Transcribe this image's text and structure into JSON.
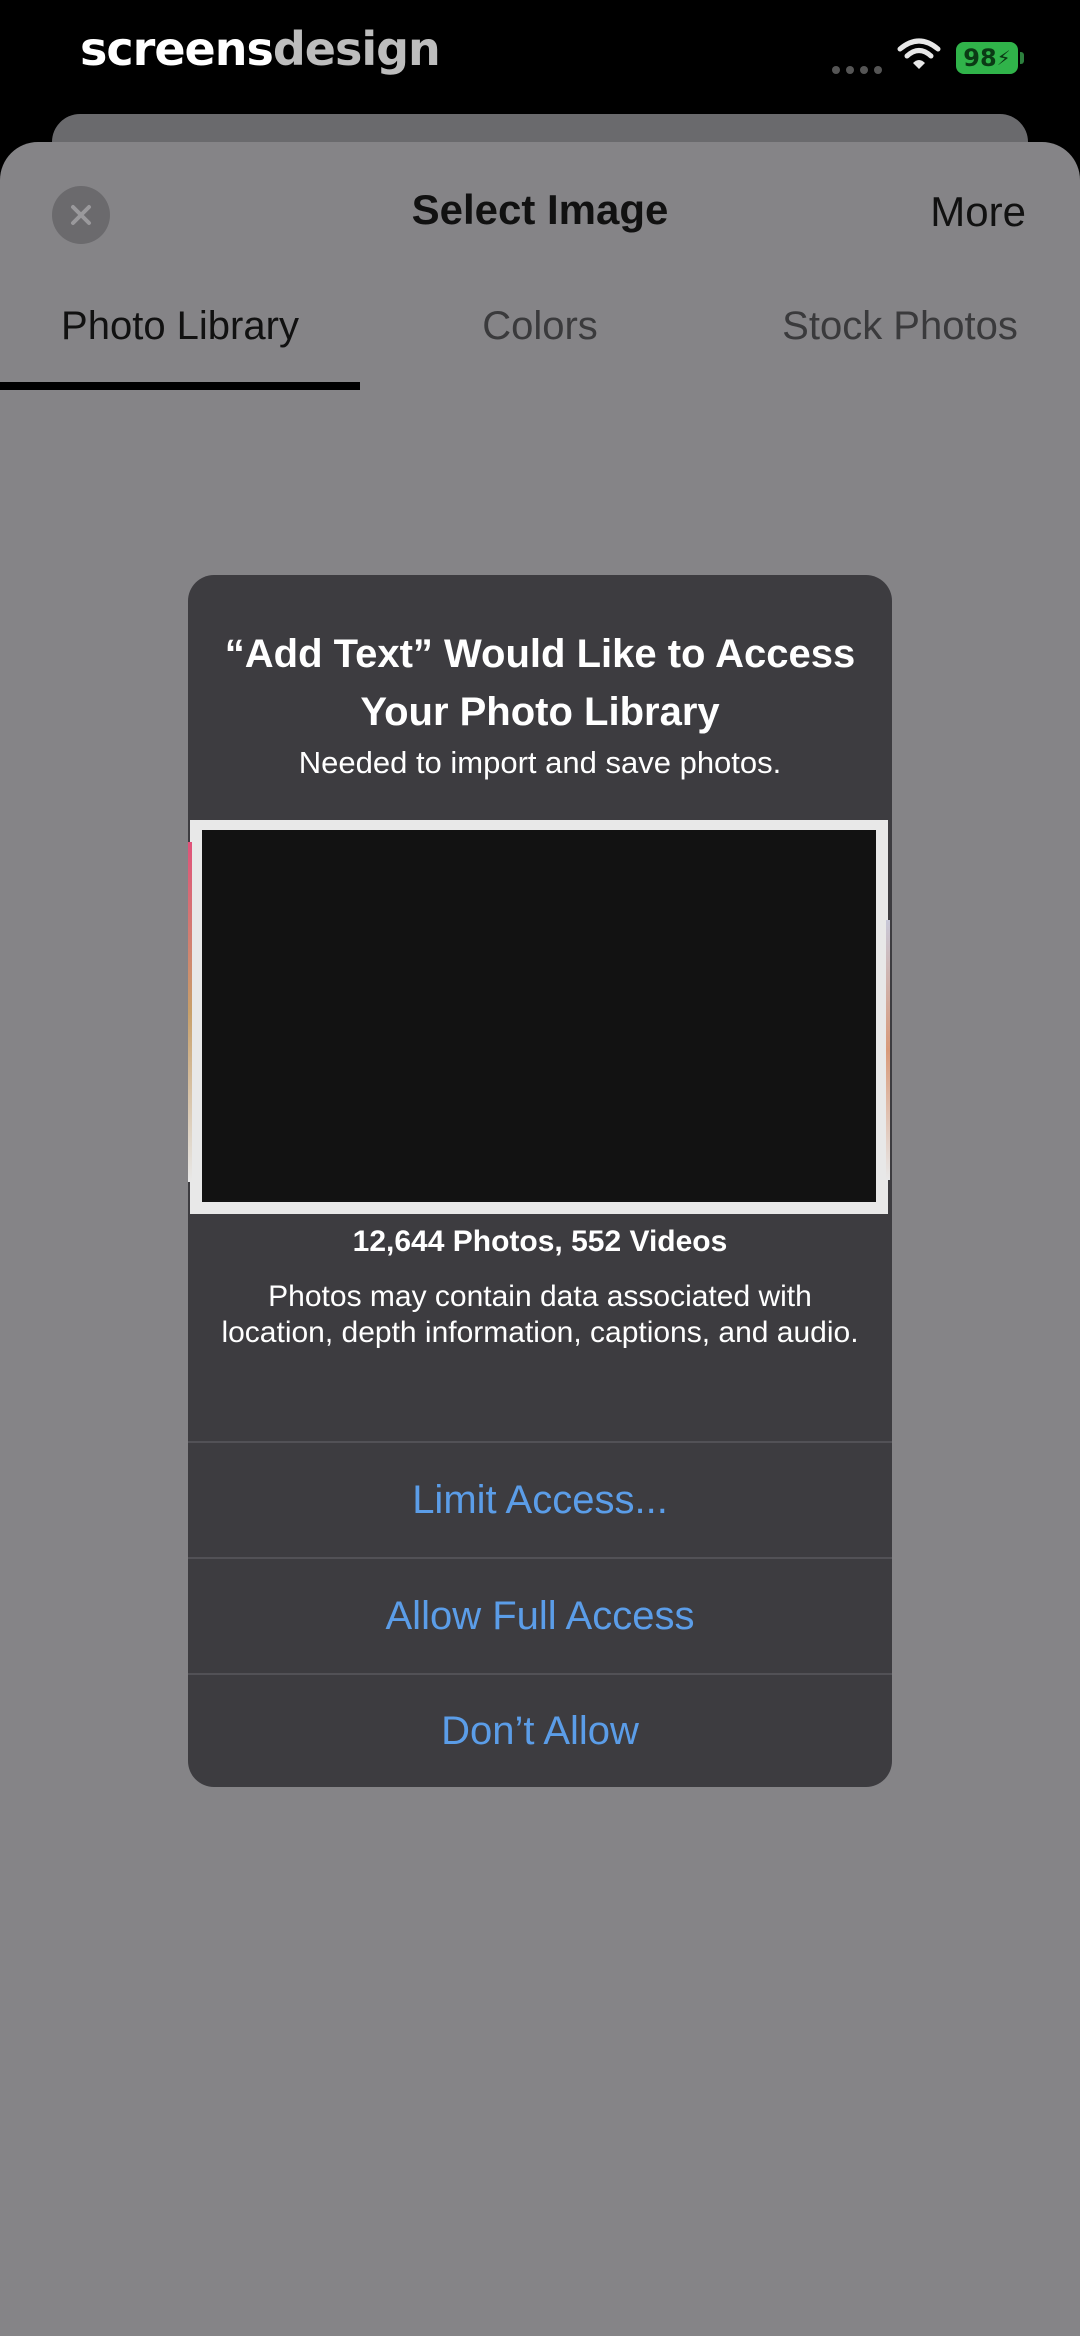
{
  "status_bar": {
    "watermark_part1": "screens",
    "watermark_part2": "design",
    "battery_level": "98",
    "battery_icon": "battery-charging-icon",
    "wifi_icon": "wifi-icon",
    "signal_icon": "cellular-signal-icon"
  },
  "sheet": {
    "title": "Select Image",
    "more_label": "More",
    "close_icon": "close-icon",
    "tabs": [
      {
        "label": "Photo Library",
        "selected": true
      },
      {
        "label": "Colors",
        "selected": false
      },
      {
        "label": "Stock Photos",
        "selected": false
      }
    ]
  },
  "alert": {
    "title": "“Add Text” Would Like to Access Your Photo Library",
    "message": "Needed to import and save photos.",
    "count": "12,644 Photos, 552 Videos",
    "detail": "Photos may contain data associated with location, depth information, captions, and audio.",
    "buttons": [
      {
        "label": "Limit Access..."
      },
      {
        "label": "Allow Full Access"
      },
      {
        "label": "Don’t Allow"
      }
    ]
  },
  "colors": {
    "background": "#000000",
    "sheet": "#858487",
    "alert": "#3d3c40",
    "alert_button_text": "#5b9de8",
    "battery": "#30b34a"
  }
}
